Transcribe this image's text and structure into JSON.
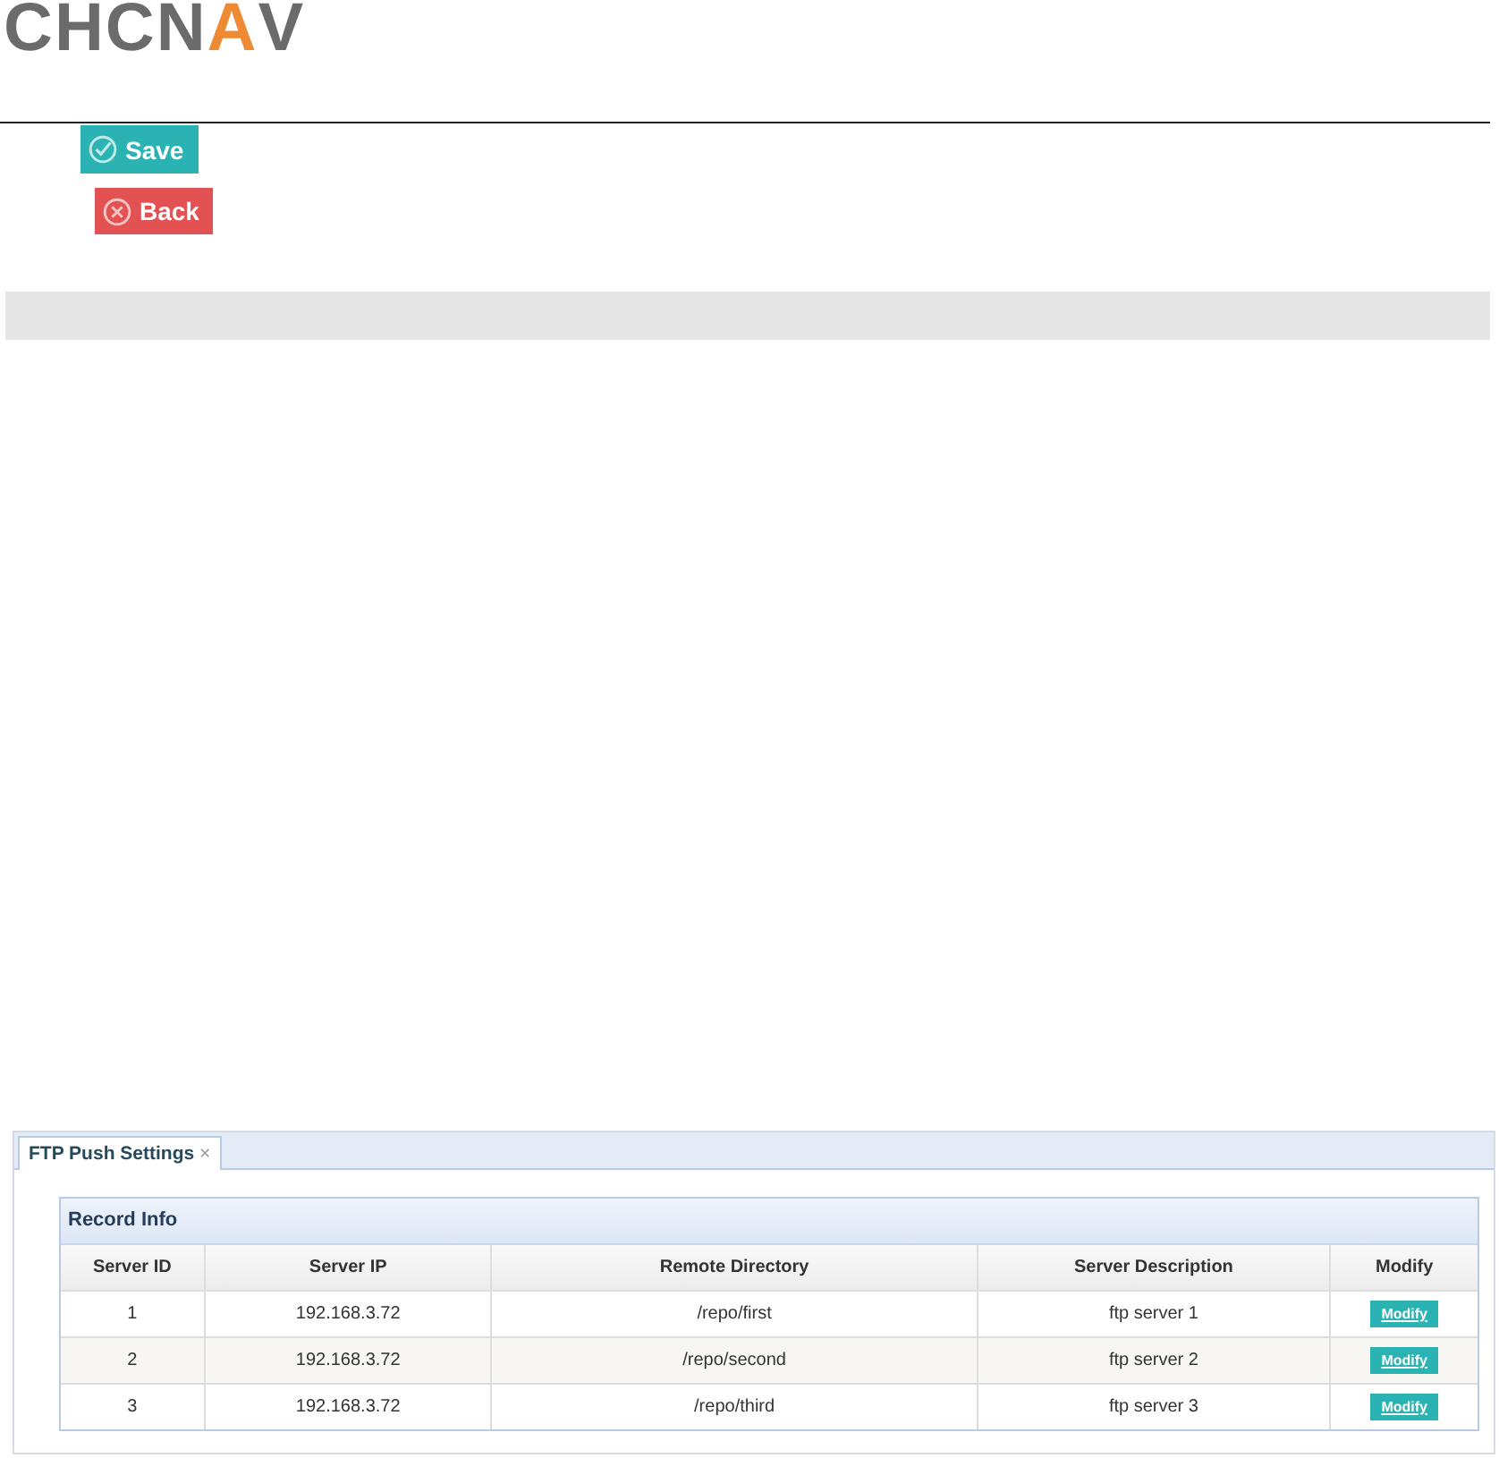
{
  "logo": {
    "text": "CHCN",
    "accent": "A",
    "tail": "V"
  },
  "buttons": [
    {
      "kind": "save",
      "label": "Save"
    },
    {
      "kind": "back",
      "label": "Back"
    }
  ],
  "panel": {
    "tab": {
      "label": "FTP Push Settings",
      "close": "×",
      "selected": true
    },
    "table": {
      "title": "Record Info",
      "columns": [
        "Server ID",
        "Server IP",
        "Remote Directory",
        "Server Description",
        "Modify"
      ],
      "rows": [
        {
          "id": "1",
          "ip": "192.168.3.72",
          "dir": "/repo/first",
          "desc": "ftp server 1",
          "action": "Modify"
        },
        {
          "id": "2",
          "ip": "192.168.3.72",
          "dir": "/repo/second",
          "desc": "ftp server 2",
          "action": "Modify"
        },
        {
          "id": "3",
          "ip": "192.168.3.72",
          "dir": "/repo/third",
          "desc": "ftp server 3",
          "action": "Modify"
        }
      ]
    }
  }
}
